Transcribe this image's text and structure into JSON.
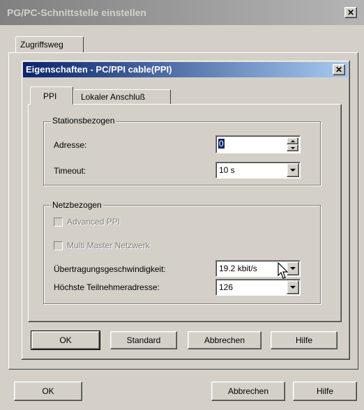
{
  "outer": {
    "title": "PG/PC-Schnittstelle einstellen",
    "tab_access": "Zugriffsweg",
    "ok": "OK",
    "cancel": "Abbrechen",
    "help": "Hilfe"
  },
  "inner": {
    "title": "Eigenschaften - PC/PPI cable(PPI)",
    "tabs": [
      {
        "label": "PPI",
        "active": true
      },
      {
        "label": "Lokaler Anschluß",
        "active": false
      }
    ],
    "station_group": {
      "title": "Stationsbezogen",
      "address_label": "Adresse:",
      "address_value": "0",
      "timeout_label": "Timeout:",
      "timeout_value": "10 s"
    },
    "network_group": {
      "title": "Netzbezogen",
      "advanced_ppi": "Advanced PPI",
      "multi_master": "Multi Master Netzwerk",
      "baud_label": "Übertragungsgeschwindigkeit:",
      "baud_value": "19.2 kbit/s",
      "highest_label": "Höchste Teilnehmeradresse:",
      "highest_value": "126"
    },
    "buttons": {
      "ok": "OK",
      "standard": "Standard",
      "cancel": "Abbrechen",
      "help": "Hilfe"
    }
  },
  "colors": {
    "face": "#d4d0c8",
    "title_active": "#0a246a",
    "title_inactive": "#808080"
  }
}
